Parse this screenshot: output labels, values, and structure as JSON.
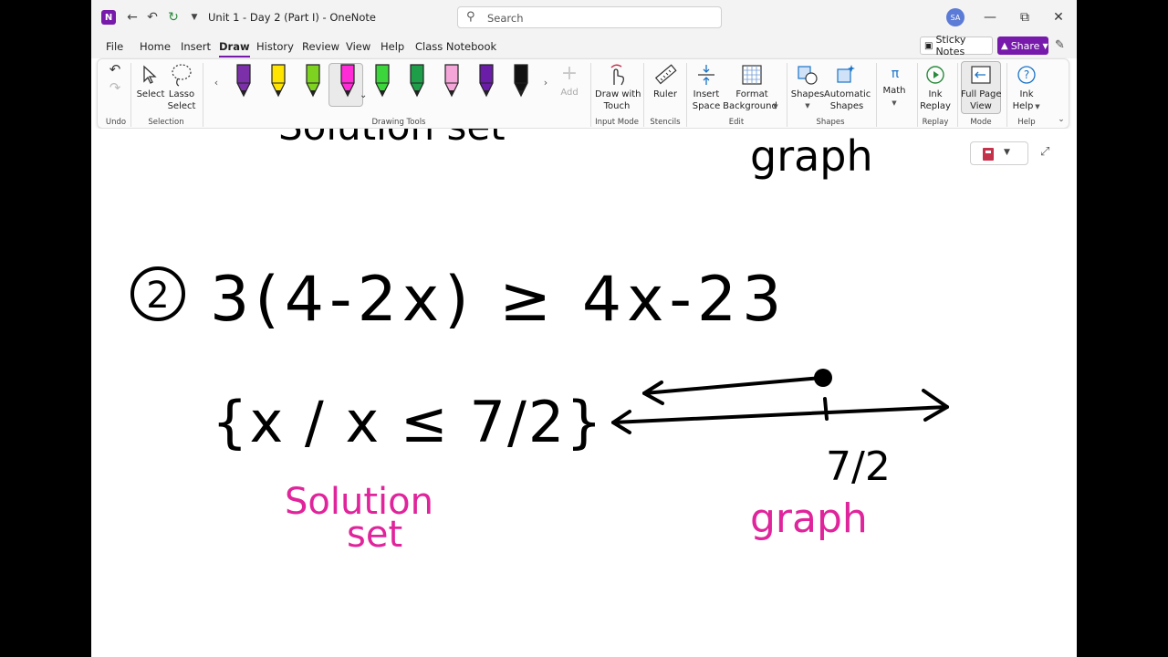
{
  "titlebar": {
    "title": "Unit 1 - Day  2 (Part I)  -  OneNote",
    "search_placeholder": "Search",
    "avatar_initials": "SA"
  },
  "menu": {
    "tabs": [
      "File",
      "Home",
      "Insert",
      "Draw",
      "History",
      "Review",
      "View",
      "Help",
      "Class Notebook"
    ],
    "active_tab": "Draw",
    "sticky_notes": "Sticky Notes",
    "share": "Share"
  },
  "ribbon": {
    "undo": "Undo",
    "select": "Select",
    "lasso_1": "Lasso",
    "lasso_2": "Select",
    "selection": "Selection",
    "drawing_tools": "Drawing Tools",
    "pen_colors": [
      "#7b2fa8",
      "#ffe400",
      "#7ed321",
      "#ff2bd6",
      "#3cd63c",
      "#1f9e4a",
      "#f4a6d8",
      "#6a1ea8",
      "#111111"
    ],
    "selected_pen_index": 3,
    "add": "Add",
    "draw_touch_1": "Draw with",
    "draw_touch_2": "Touch",
    "input_mode": "Input Mode",
    "ruler": "Ruler",
    "stencils": "Stencils",
    "insert_space_1": "Insert",
    "insert_space_2": "Space",
    "format_bg_1": "Format",
    "format_bg_2": "Background",
    "edit": "Edit",
    "shapes_btn": "Shapes",
    "auto_shapes_1": "Automatic",
    "auto_shapes_2": "Shapes",
    "shapes_grp": "Shapes",
    "math": "Math",
    "ink_replay_1": "Ink",
    "ink_replay_2": "Replay",
    "replay": "Replay",
    "full_page_1": "Full Page",
    "full_page_2": "View",
    "mode": "Mode",
    "ink_help_1": "Ink",
    "ink_help_2": "Help",
    "help": "Help"
  },
  "ink": {
    "header_left": "Solution set",
    "header_right": "graph",
    "problem_number": "2",
    "inequality": "3(4-2x) ≥ 4x-23",
    "solution_set": "{x / x ≤ 7/2}",
    "tick_label": "7/2",
    "label_solution_1": "Solution",
    "label_solution_2": "set",
    "label_graph": "graph",
    "ink_color": "#000000",
    "highlight_color": "#e0249b"
  }
}
